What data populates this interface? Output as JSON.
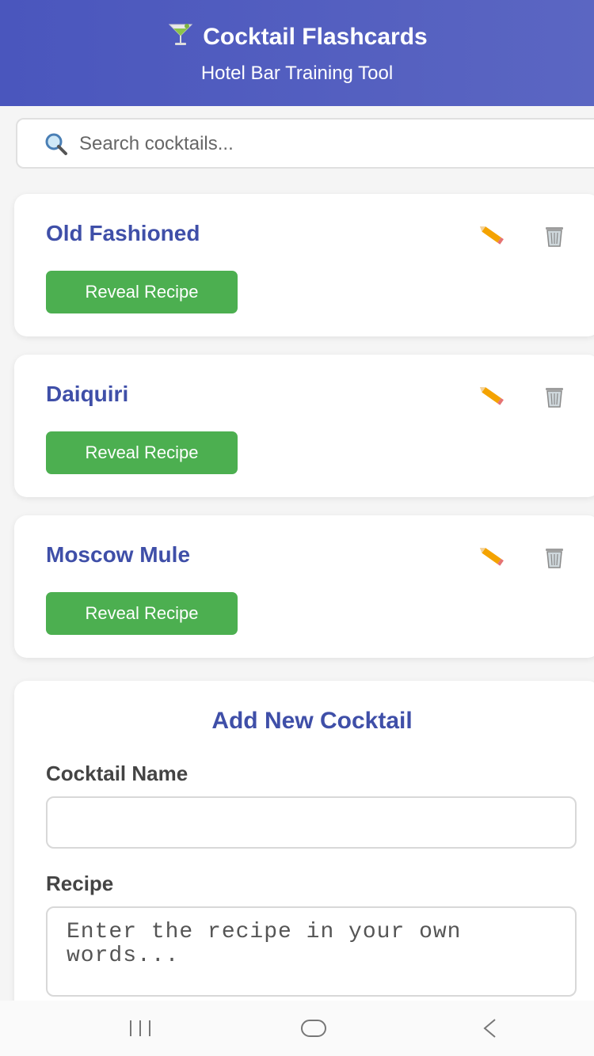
{
  "header": {
    "icon": "cocktail-glass-icon",
    "title": "Cocktail Flashcards",
    "subtitle": "Hotel Bar Training Tool"
  },
  "search": {
    "icon": "search-icon",
    "placeholder": "Search cocktails..."
  },
  "cocktails": [
    {
      "name": "Old Fashioned",
      "reveal_label": "Reveal Recipe"
    },
    {
      "name": "Daiquiri",
      "reveal_label": "Reveal Recipe"
    },
    {
      "name": "Moscow Mule",
      "reveal_label": "Reveal Recipe"
    }
  ],
  "add_form": {
    "title": "Add New Cocktail",
    "name_label": "Cocktail Name",
    "name_value": "",
    "recipe_label": "Recipe",
    "recipe_placeholder": "Enter the recipe in your own words..."
  },
  "colors": {
    "header": "#4a56bd",
    "accent_text": "#3f4fa8",
    "reveal_button": "#4caf50"
  },
  "system_nav": {
    "recents": "recents-icon",
    "home": "home-icon",
    "back": "back-icon"
  }
}
